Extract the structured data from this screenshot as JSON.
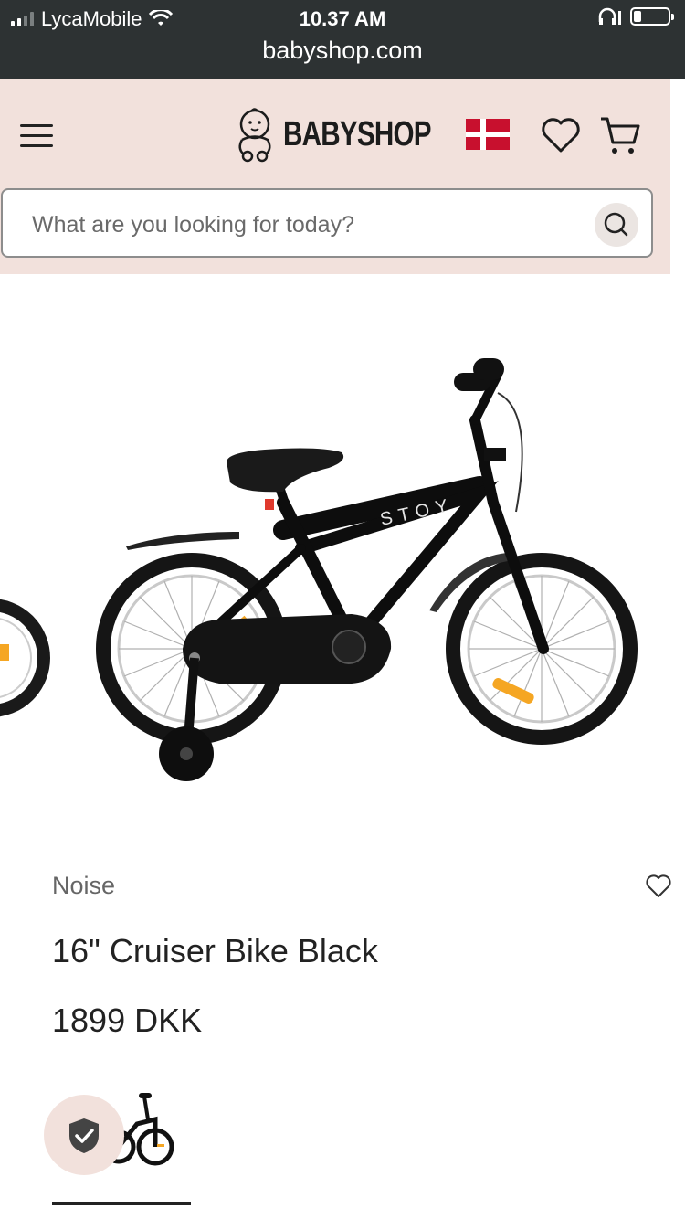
{
  "status_bar": {
    "carrier": "LycaMobile",
    "time": "10.37 AM",
    "url": "babyshop.com"
  },
  "header": {
    "logo_text": "BABYSHOP",
    "country_flag": "denmark-flag",
    "icons": [
      "menu-icon",
      "heart-icon",
      "cart-icon"
    ]
  },
  "search": {
    "placeholder": "What are you looking for today?",
    "icon": "search-icon"
  },
  "product": {
    "brand": "Noise",
    "title": "16\" Cruiser Bike Black",
    "price": "1899 DKK",
    "image_text": "STOY"
  },
  "colors": {
    "status_bg": "#2d3233",
    "header_bg": "#f2e1dc",
    "flag_red": "#c8102e"
  }
}
